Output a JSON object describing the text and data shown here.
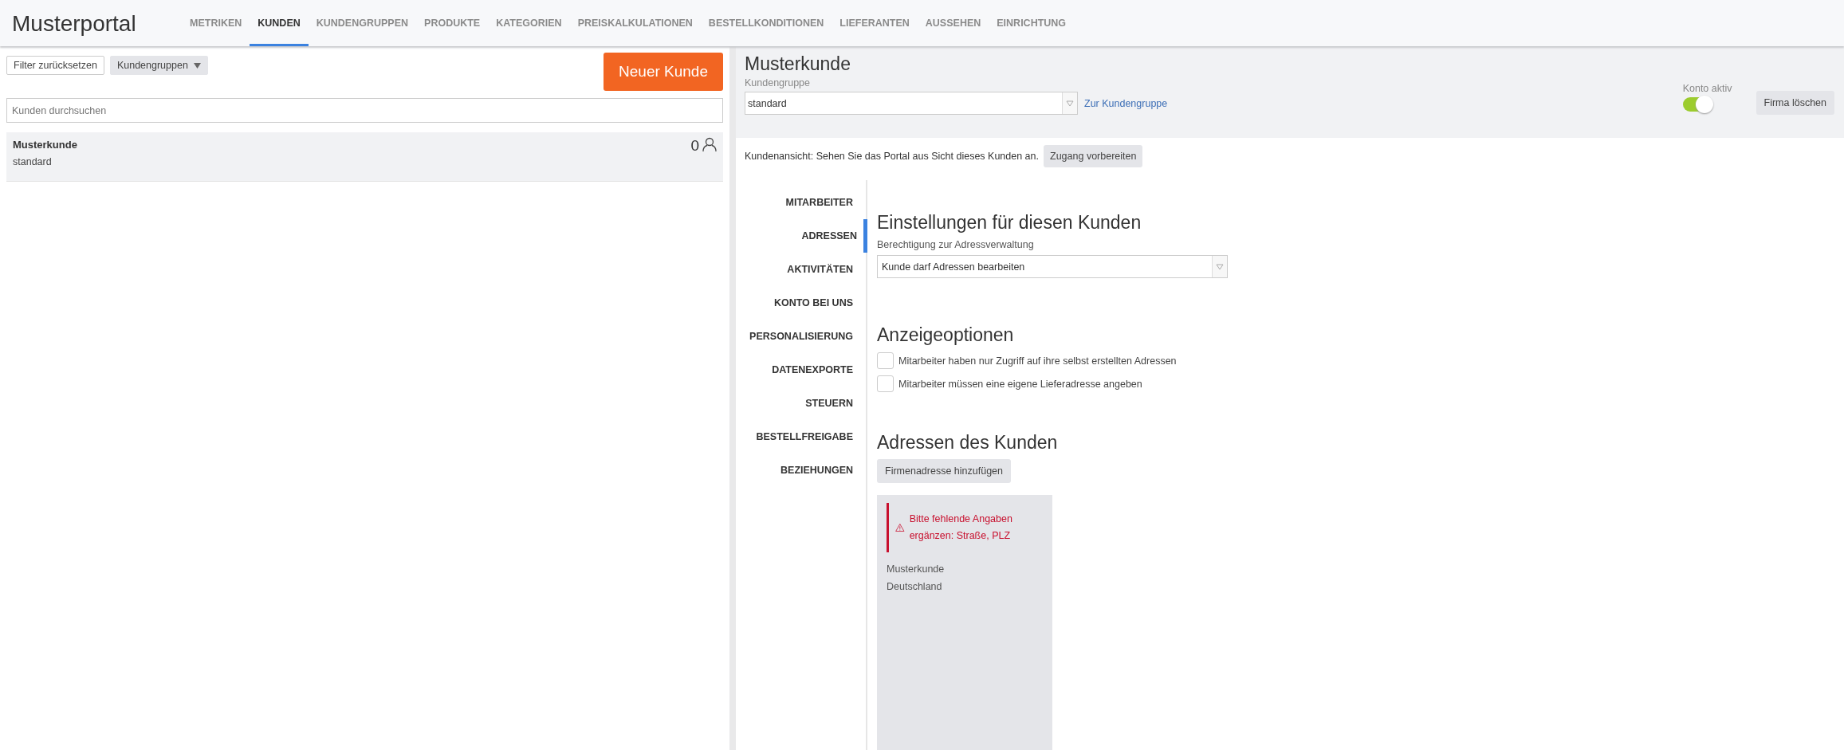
{
  "app": {
    "logo": "Musterportal"
  },
  "nav_tabs": [
    {
      "label": "METRIKEN",
      "selected": false
    },
    {
      "label": "KUNDEN",
      "selected": true
    },
    {
      "label": "KUNDENGRUPPEN",
      "selected": false
    },
    {
      "label": "PRODUKTE",
      "selected": false
    },
    {
      "label": "KATEGORIEN",
      "selected": false
    },
    {
      "label": "PREISKALKULATIONEN",
      "selected": false
    },
    {
      "label": "BESTELLKONDITIONEN",
      "selected": false
    },
    {
      "label": "LIEFERANTEN",
      "selected": false
    },
    {
      "label": "AUSSEHEN",
      "selected": false
    },
    {
      "label": "EINRICHTUNG",
      "selected": false
    }
  ],
  "customer_list": {
    "reset_button": "Filter zurücksetzen",
    "group_filter": "Kundengruppen",
    "new_button": "Neuer Kunde",
    "search": {
      "placeholder": "Kunden durchsuchen"
    },
    "customers": [
      {
        "name": "Musterkunde",
        "group": "standard",
        "count": "0",
        "selected": true
      }
    ]
  },
  "customer_detail": {
    "title": "Musterkunde",
    "group_label": "Kundengruppe",
    "group_value": "standard",
    "group_link": "Zur Kundengruppe",
    "account_active_label": "Konto aktiv",
    "account_active": true,
    "delete_button": "Firma löschen",
    "preview_text": "Kundenansicht: Sehen Sie das Portal aus Sicht dieses Kunden an.",
    "preview_button": "Zugang vorbereiten"
  },
  "section_nav": [
    {
      "label": "MITARBEITER",
      "selected": false
    },
    {
      "label": "ADRESSEN",
      "selected": true
    },
    {
      "label": "AKTIVITÄTEN",
      "selected": false
    },
    {
      "label": "KONTO BEI UNS",
      "selected": false
    },
    {
      "label": "PERSONALISIERUNG",
      "selected": false
    },
    {
      "label": "DATENEXPORTE",
      "selected": false
    },
    {
      "label": "STEUERN",
      "selected": false
    },
    {
      "label": "BESTELLFREIGABE",
      "selected": false
    },
    {
      "label": "BEZIEHUNGEN",
      "selected": false
    }
  ],
  "address_settings": {
    "heading": "Einstellungen für diesen Kunden",
    "permission_label": "Berechtigung zur Adressverwaltung",
    "permission_value": "Kunde darf Adressen bearbeiten",
    "display_heading": "Anzeigeoptionen",
    "options": [
      {
        "label": "Mitarbeiter haben nur Zugriff auf ihre selbst erstellten Adressen",
        "checked": false
      },
      {
        "label": "Mitarbeiter müssen eine eigene Lieferadresse angeben",
        "checked": false
      }
    ],
    "addresses_heading": "Adressen des Kunden",
    "add_button": "Firmenadresse hinzufügen",
    "addresses": [
      {
        "warning": "Bitte fehlende Angaben ergänzen: Straße, PLZ",
        "lines": [
          "Musterkunde",
          "Deutschland"
        ]
      }
    ]
  }
}
